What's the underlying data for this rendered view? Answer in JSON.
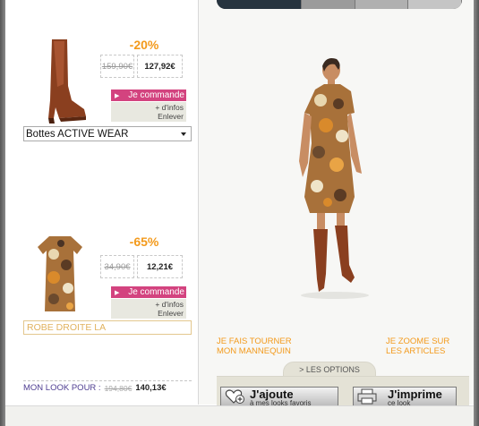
{
  "products": [
    {
      "discount": "-20%",
      "old_price": "159,90€",
      "new_price": "127,92€",
      "order_label": "Je commande",
      "more_info_label": "+ d'infos",
      "remove_label": "Enlever",
      "selected_name": "Bottes ACTIVE WEAR"
    },
    {
      "discount": "-65%",
      "old_price": "34,90€",
      "new_price": "12,21€",
      "order_label": "Je commande",
      "more_info_label": "+ d'infos",
      "remove_label": "Enlever",
      "selected_name": "ROBE DROITE LA"
    }
  ],
  "look": {
    "label": "MON LOOK POUR :",
    "old_total": "194,80€",
    "new_total": "140,13€"
  },
  "stage": {
    "rotate_link": [
      "JE FAIS TOURNER",
      "MON MANNEQUIN"
    ],
    "zoom_link": [
      "JE ZOOME SUR",
      "LES ARTICLES"
    ],
    "options_tab": "> LES OPTIONS"
  },
  "actions": {
    "add": {
      "main": "J'ajoute",
      "sub": "à mes looks favoris"
    },
    "print": {
      "main": "J'imprime",
      "sub": "ce look"
    }
  },
  "colors": {
    "accent_orange": "#f39a1c",
    "order_pink": "#d3437f",
    "look_purple": "#4f3e92"
  }
}
